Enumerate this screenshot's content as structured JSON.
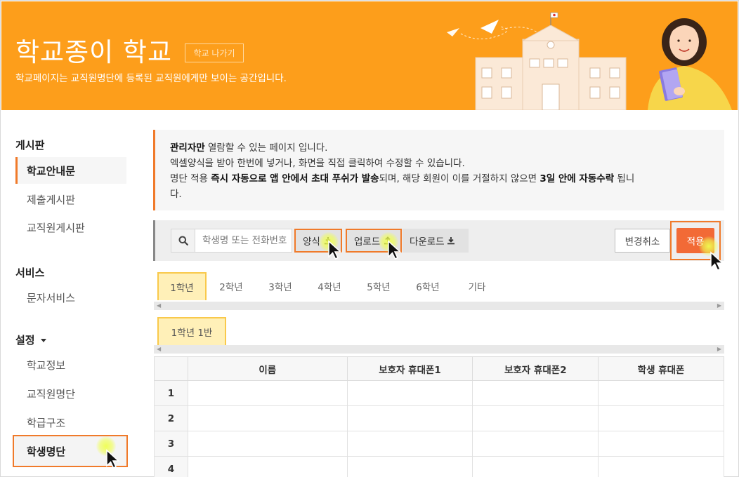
{
  "header": {
    "title": "학교종이 학교",
    "exit_label": "학교 나가기",
    "description": "학교페이지는 교직원명단에 등록된 교직원에게만 보이는 공간입니다."
  },
  "sidebar": {
    "group_board": "게시판",
    "board_items": [
      "학교안내문",
      "제출게시판",
      "교직원게시판"
    ],
    "group_service": "서비스",
    "service_items": [
      "문자서비스"
    ],
    "group_settings": "설정",
    "settings_items": [
      "학교정보",
      "교직원명단",
      "학급구조",
      "학생명단"
    ]
  },
  "notice": {
    "line1_bold": "관리자만",
    "line1_rest": " 열람할 수 있는 페이지 입니다.",
    "line2": "엑셀양식을 받아 한번에 넣거나, 화면을 직접 클릭하여 수정할 수 있습니다.",
    "line3_a": "명단 적용 ",
    "line3_bold1": "즉시 자동으로 앱 안에서 초대 푸쉬가 발송",
    "line3_b": "되며, 해당 회원이 이를 거절하지 않으면 ",
    "line3_bold2": "3일 안에 자동수락",
    "line3_c": " 됩니",
    "line4": "다."
  },
  "toolbar": {
    "search_placeholder": "학생명 또는 전화번호",
    "template_label": "양식",
    "upload_label": "업로드",
    "download_label": "다운로드",
    "cancel_label": "변경취소",
    "apply_label": "적용"
  },
  "grade_tabs": [
    "1학년",
    "2학년",
    "3학년",
    "4학년",
    "5학년",
    "6학년",
    "기타"
  ],
  "class_tab": "1학년 1반",
  "table": {
    "headers": [
      "이름",
      "보호자 휴대폰1",
      "보호자 휴대폰2",
      "학생 휴대폰"
    ],
    "row_numbers": [
      "1",
      "2",
      "3",
      "4"
    ]
  },
  "icons": {
    "search": "search-icon",
    "download": "download-icon",
    "cursor": "mouse-pointer-icon"
  },
  "colors": {
    "banner": "#fd9e1b",
    "accent": "#f07a2a",
    "apply": "#f26a36",
    "tab_active": "#fff0b8"
  }
}
